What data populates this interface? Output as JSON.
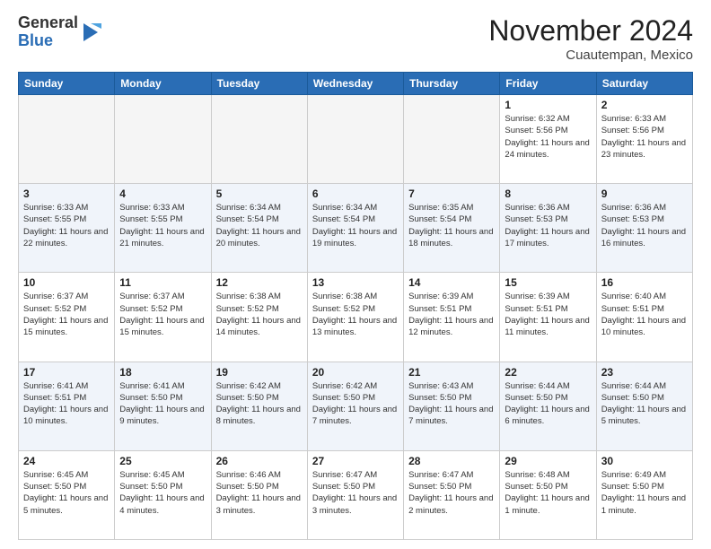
{
  "header": {
    "logo_general": "General",
    "logo_blue": "Blue",
    "month_title": "November 2024",
    "location": "Cuautempan, Mexico"
  },
  "weekdays": [
    "Sunday",
    "Monday",
    "Tuesday",
    "Wednesday",
    "Thursday",
    "Friday",
    "Saturday"
  ],
  "weeks": [
    [
      {
        "day": "",
        "info": "",
        "empty": true
      },
      {
        "day": "",
        "info": "",
        "empty": true
      },
      {
        "day": "",
        "info": "",
        "empty": true
      },
      {
        "day": "",
        "info": "",
        "empty": true
      },
      {
        "day": "",
        "info": "",
        "empty": true
      },
      {
        "day": "1",
        "info": "Sunrise: 6:32 AM\nSunset: 5:56 PM\nDaylight: 11 hours and 24 minutes."
      },
      {
        "day": "2",
        "info": "Sunrise: 6:33 AM\nSunset: 5:56 PM\nDaylight: 11 hours and 23 minutes."
      }
    ],
    [
      {
        "day": "3",
        "info": "Sunrise: 6:33 AM\nSunset: 5:55 PM\nDaylight: 11 hours and 22 minutes."
      },
      {
        "day": "4",
        "info": "Sunrise: 6:33 AM\nSunset: 5:55 PM\nDaylight: 11 hours and 21 minutes."
      },
      {
        "day": "5",
        "info": "Sunrise: 6:34 AM\nSunset: 5:54 PM\nDaylight: 11 hours and 20 minutes."
      },
      {
        "day": "6",
        "info": "Sunrise: 6:34 AM\nSunset: 5:54 PM\nDaylight: 11 hours and 19 minutes."
      },
      {
        "day": "7",
        "info": "Sunrise: 6:35 AM\nSunset: 5:54 PM\nDaylight: 11 hours and 18 minutes."
      },
      {
        "day": "8",
        "info": "Sunrise: 6:36 AM\nSunset: 5:53 PM\nDaylight: 11 hours and 17 minutes."
      },
      {
        "day": "9",
        "info": "Sunrise: 6:36 AM\nSunset: 5:53 PM\nDaylight: 11 hours and 16 minutes."
      }
    ],
    [
      {
        "day": "10",
        "info": "Sunrise: 6:37 AM\nSunset: 5:52 PM\nDaylight: 11 hours and 15 minutes."
      },
      {
        "day": "11",
        "info": "Sunrise: 6:37 AM\nSunset: 5:52 PM\nDaylight: 11 hours and 15 minutes."
      },
      {
        "day": "12",
        "info": "Sunrise: 6:38 AM\nSunset: 5:52 PM\nDaylight: 11 hours and 14 minutes."
      },
      {
        "day": "13",
        "info": "Sunrise: 6:38 AM\nSunset: 5:52 PM\nDaylight: 11 hours and 13 minutes."
      },
      {
        "day": "14",
        "info": "Sunrise: 6:39 AM\nSunset: 5:51 PM\nDaylight: 11 hours and 12 minutes."
      },
      {
        "day": "15",
        "info": "Sunrise: 6:39 AM\nSunset: 5:51 PM\nDaylight: 11 hours and 11 minutes."
      },
      {
        "day": "16",
        "info": "Sunrise: 6:40 AM\nSunset: 5:51 PM\nDaylight: 11 hours and 10 minutes."
      }
    ],
    [
      {
        "day": "17",
        "info": "Sunrise: 6:41 AM\nSunset: 5:51 PM\nDaylight: 11 hours and 10 minutes."
      },
      {
        "day": "18",
        "info": "Sunrise: 6:41 AM\nSunset: 5:50 PM\nDaylight: 11 hours and 9 minutes."
      },
      {
        "day": "19",
        "info": "Sunrise: 6:42 AM\nSunset: 5:50 PM\nDaylight: 11 hours and 8 minutes."
      },
      {
        "day": "20",
        "info": "Sunrise: 6:42 AM\nSunset: 5:50 PM\nDaylight: 11 hours and 7 minutes."
      },
      {
        "day": "21",
        "info": "Sunrise: 6:43 AM\nSunset: 5:50 PM\nDaylight: 11 hours and 7 minutes."
      },
      {
        "day": "22",
        "info": "Sunrise: 6:44 AM\nSunset: 5:50 PM\nDaylight: 11 hours and 6 minutes."
      },
      {
        "day": "23",
        "info": "Sunrise: 6:44 AM\nSunset: 5:50 PM\nDaylight: 11 hours and 5 minutes."
      }
    ],
    [
      {
        "day": "24",
        "info": "Sunrise: 6:45 AM\nSunset: 5:50 PM\nDaylight: 11 hours and 5 minutes."
      },
      {
        "day": "25",
        "info": "Sunrise: 6:45 AM\nSunset: 5:50 PM\nDaylight: 11 hours and 4 minutes."
      },
      {
        "day": "26",
        "info": "Sunrise: 6:46 AM\nSunset: 5:50 PM\nDaylight: 11 hours and 3 minutes."
      },
      {
        "day": "27",
        "info": "Sunrise: 6:47 AM\nSunset: 5:50 PM\nDaylight: 11 hours and 3 minutes."
      },
      {
        "day": "28",
        "info": "Sunrise: 6:47 AM\nSunset: 5:50 PM\nDaylight: 11 hours and 2 minutes."
      },
      {
        "day": "29",
        "info": "Sunrise: 6:48 AM\nSunset: 5:50 PM\nDaylight: 11 hours and 1 minute."
      },
      {
        "day": "30",
        "info": "Sunrise: 6:49 AM\nSunset: 5:50 PM\nDaylight: 11 hours and 1 minute."
      }
    ]
  ]
}
